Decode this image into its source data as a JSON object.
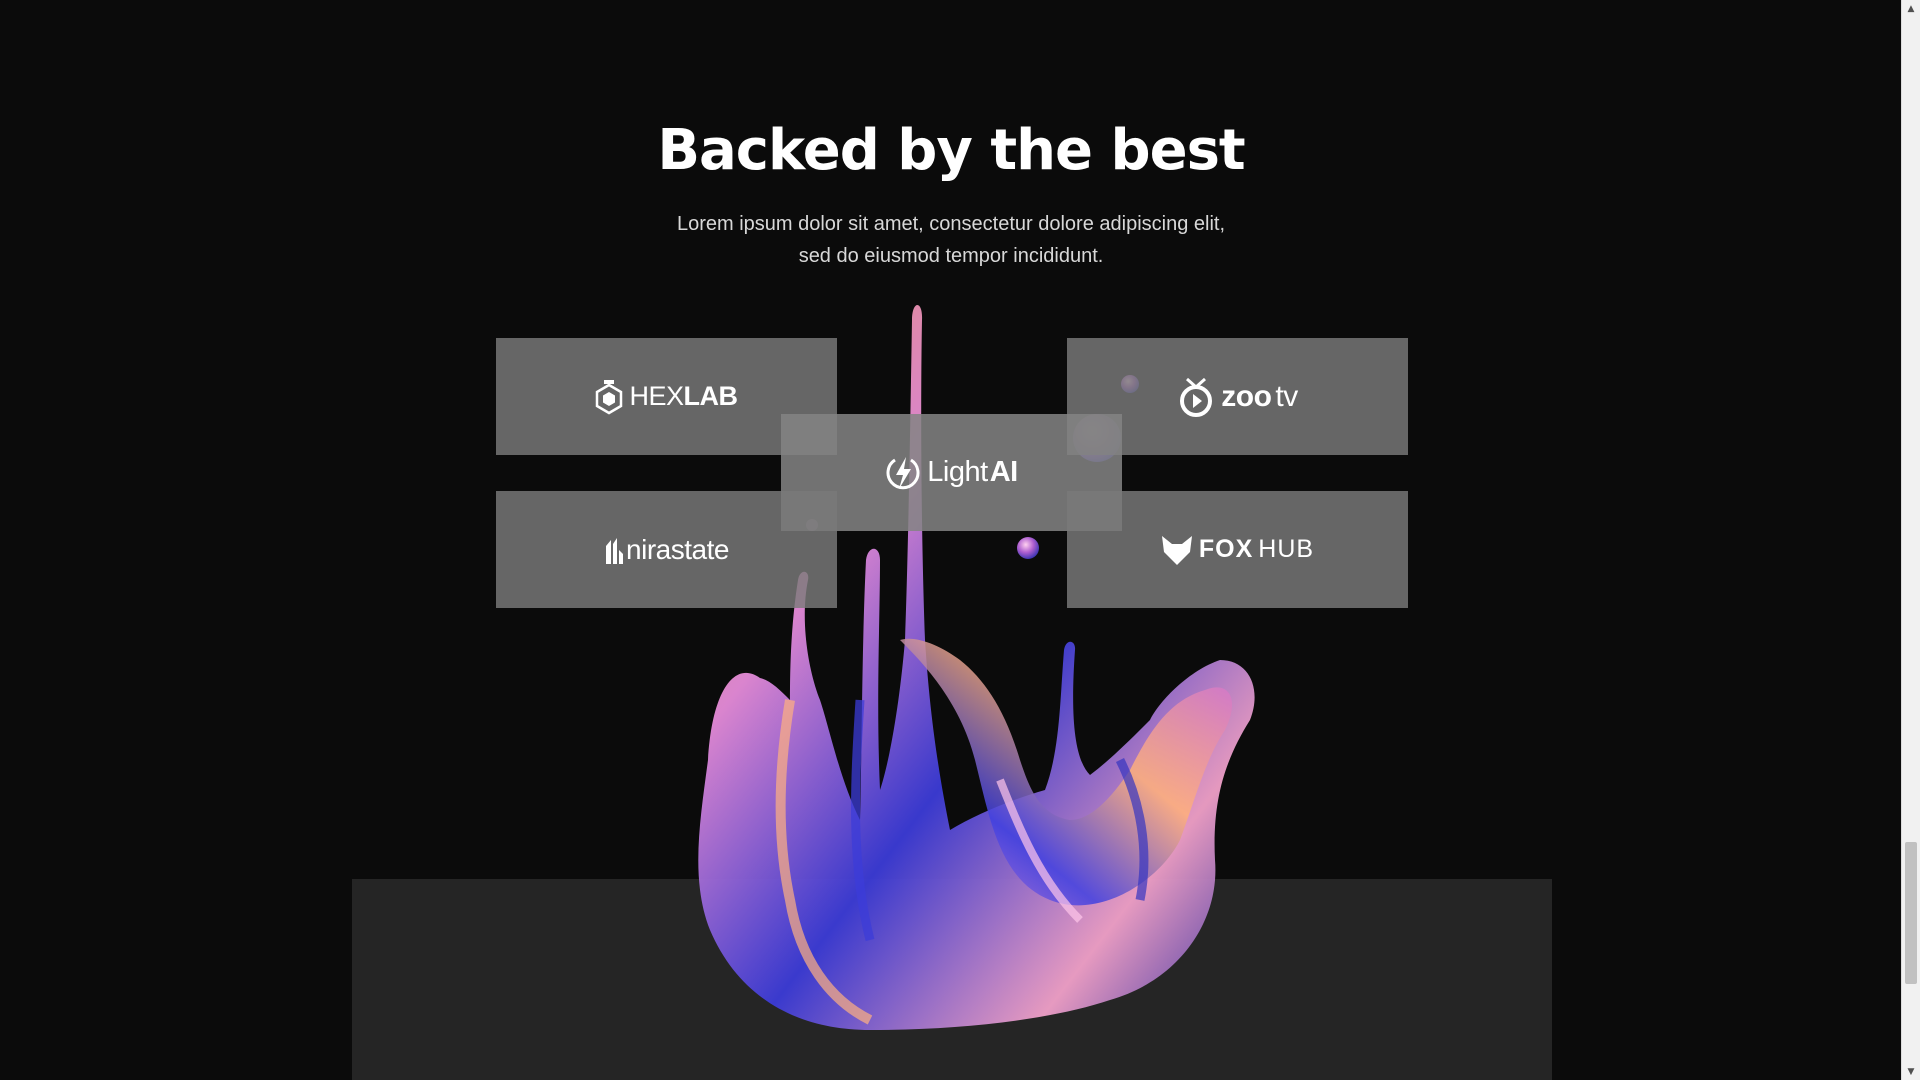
{
  "section": {
    "title": "Backed by the best",
    "subtitle_line1": "Lorem ipsum dolor sit amet, consectetur dolore adipiscing elit,",
    "subtitle_line2": "sed do eiusmod tempor incididunt."
  },
  "logos": {
    "hexlab": {
      "part1": "HEX",
      "part2": "LAB",
      "icon": "hexagon-flask-icon"
    },
    "zootv": {
      "part1": "zoo",
      "part2": "tv",
      "icon": "tv-play-icon"
    },
    "lightai": {
      "part1": "Light",
      "part2": "AI",
      "icon": "lightning-bolt-icon"
    },
    "nirastate": {
      "part1": "nirastate",
      "icon": "buildings-icon"
    },
    "foxhub": {
      "part1": "FOX",
      "part2": "HUB",
      "icon": "fox-head-icon"
    }
  },
  "colors": {
    "background": "#0b0b0b",
    "card": "#7a7a7a",
    "bottom_panel": "#252525",
    "splash_pink": "#e58bd8",
    "splash_blue": "#3b3bd6",
    "splash_orange": "#f29a6a"
  },
  "scrollbar": {
    "up_icon": "scroll-up-arrow-icon",
    "down_icon": "scroll-down-arrow-icon"
  }
}
